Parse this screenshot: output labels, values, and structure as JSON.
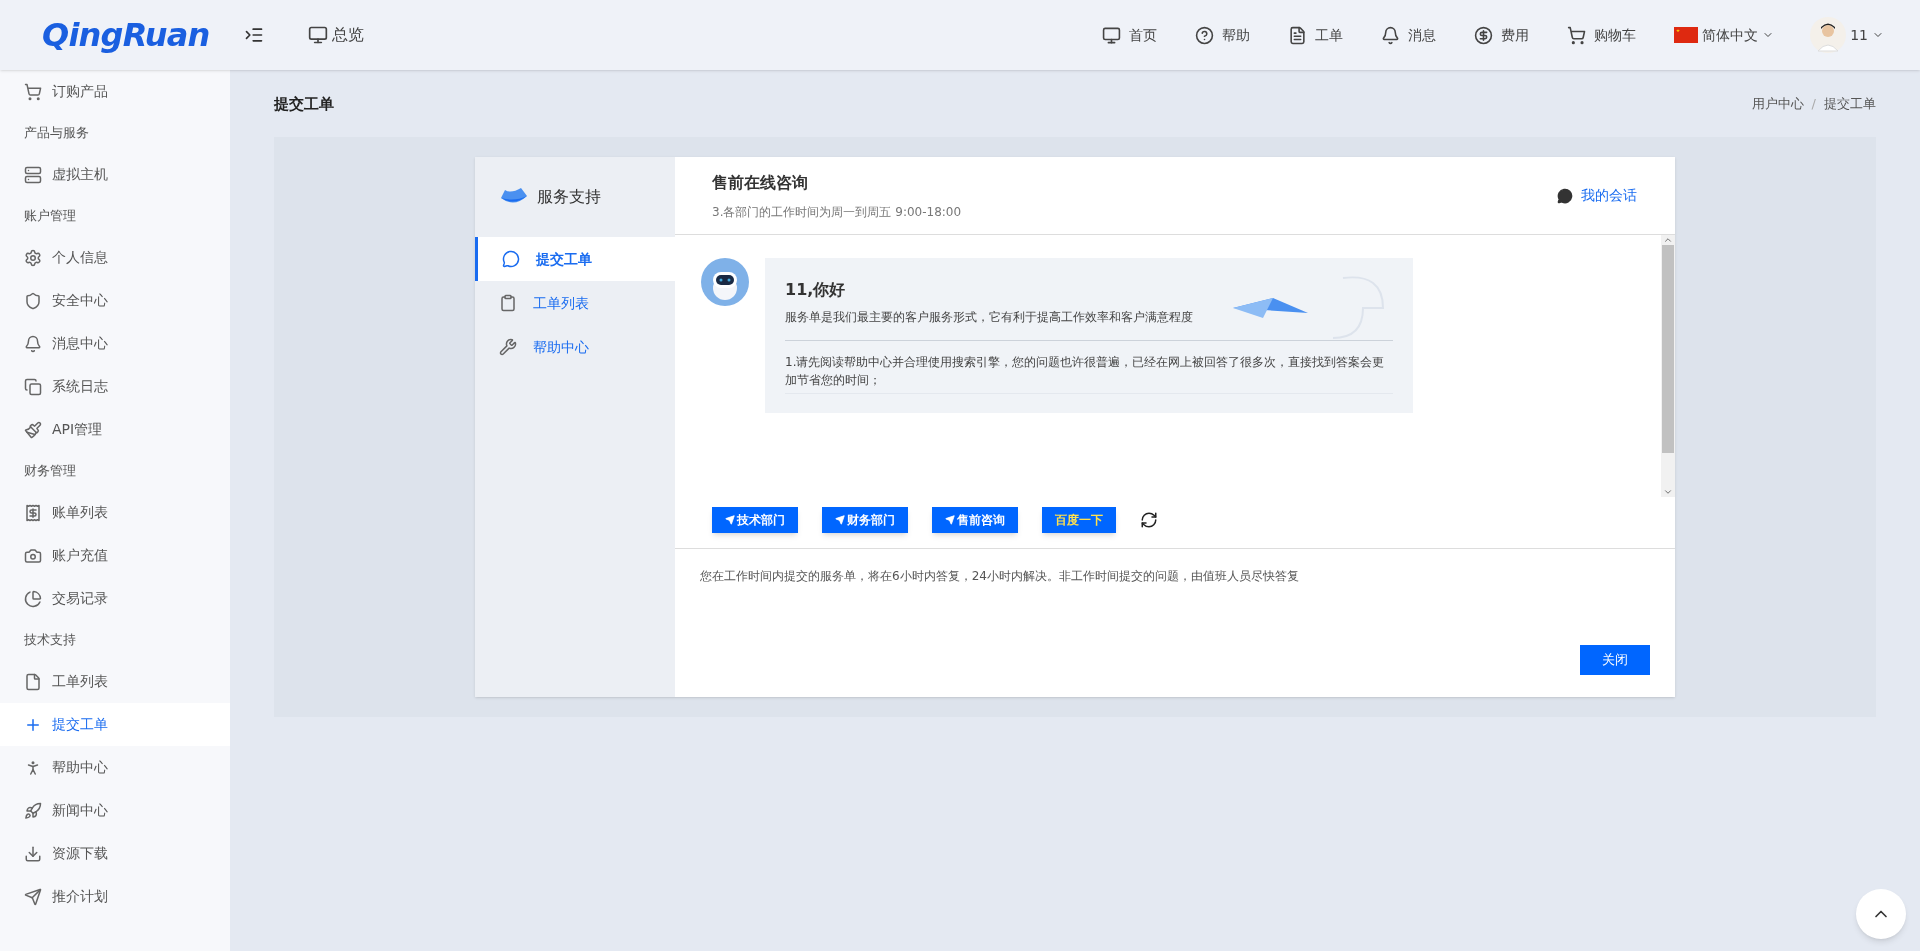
{
  "header": {
    "logo": "QingRuan",
    "overview": "总览",
    "nav": [
      "首页",
      "帮助",
      "工单",
      "消息",
      "费用",
      "购物车"
    ],
    "language": "简体中文",
    "user": "11"
  },
  "sidebar": [
    {
      "kind": "item",
      "label": "订购产品",
      "selected": false
    },
    {
      "kind": "section",
      "label": "产品与服务"
    },
    {
      "kind": "item",
      "label": "虚拟主机",
      "selected": false
    },
    {
      "kind": "section",
      "label": "账户管理"
    },
    {
      "kind": "item",
      "label": "个人信息",
      "selected": false
    },
    {
      "kind": "item",
      "label": "安全中心",
      "selected": false
    },
    {
      "kind": "item",
      "label": "消息中心",
      "selected": false
    },
    {
      "kind": "item",
      "label": "系统日志",
      "selected": false
    },
    {
      "kind": "item",
      "label": "API管理",
      "selected": false
    },
    {
      "kind": "section",
      "label": "财务管理"
    },
    {
      "kind": "item",
      "label": "账单列表",
      "selected": false
    },
    {
      "kind": "item",
      "label": "账户充值",
      "selected": false
    },
    {
      "kind": "item",
      "label": "交易记录",
      "selected": false
    },
    {
      "kind": "section",
      "label": "技术支持"
    },
    {
      "kind": "item",
      "label": "工单列表",
      "selected": false
    },
    {
      "kind": "item",
      "label": "提交工单",
      "selected": true
    },
    {
      "kind": "item",
      "label": "帮助中心",
      "selected": false
    },
    {
      "kind": "item",
      "label": "新闻中心",
      "selected": false
    },
    {
      "kind": "item",
      "label": "资源下载",
      "selected": false
    },
    {
      "kind": "item",
      "label": "推介计划",
      "selected": false
    }
  ],
  "page": {
    "title": "提交工单",
    "breadcrumb": [
      "用户中心",
      "提交工单"
    ],
    "breadcrumb_separator": "/"
  },
  "card": {
    "brand": "服务支持",
    "nav": [
      {
        "label": "提交工单",
        "selected": true
      },
      {
        "label": "工单列表",
        "selected": false
      },
      {
        "label": "帮助中心",
        "selected": false
      }
    ],
    "title": "售前在线咨询",
    "subtitle": "3.各部门的工作时间为周一到周五 9:00-18:00",
    "my_sessions": "我的会话",
    "message": {
      "greeting": "11,你好",
      "intro": "服务单是我们最主要的客户服务形式，它有利于提高工作效率和客户满意程度",
      "note": "1.请先阅读帮助中心并合理使用搜索引擎，您的问题也许很普遍，已经在网上被回答了很多次，直接找到答案会更加节省您的时间；"
    },
    "quick_buttons": [
      {
        "kind": "department",
        "label": "技术部门"
      },
      {
        "kind": "department",
        "label": "财务部门"
      },
      {
        "kind": "department",
        "label": "售前咨询"
      },
      {
        "kind": "search",
        "label": "百度一下"
      }
    ],
    "notice": "您在工作时间内提交的服务单，将在6小时内答复，24小时内解决。非工作时间提交的问题，由值班人员尽快答复",
    "close": "关闭"
  }
}
